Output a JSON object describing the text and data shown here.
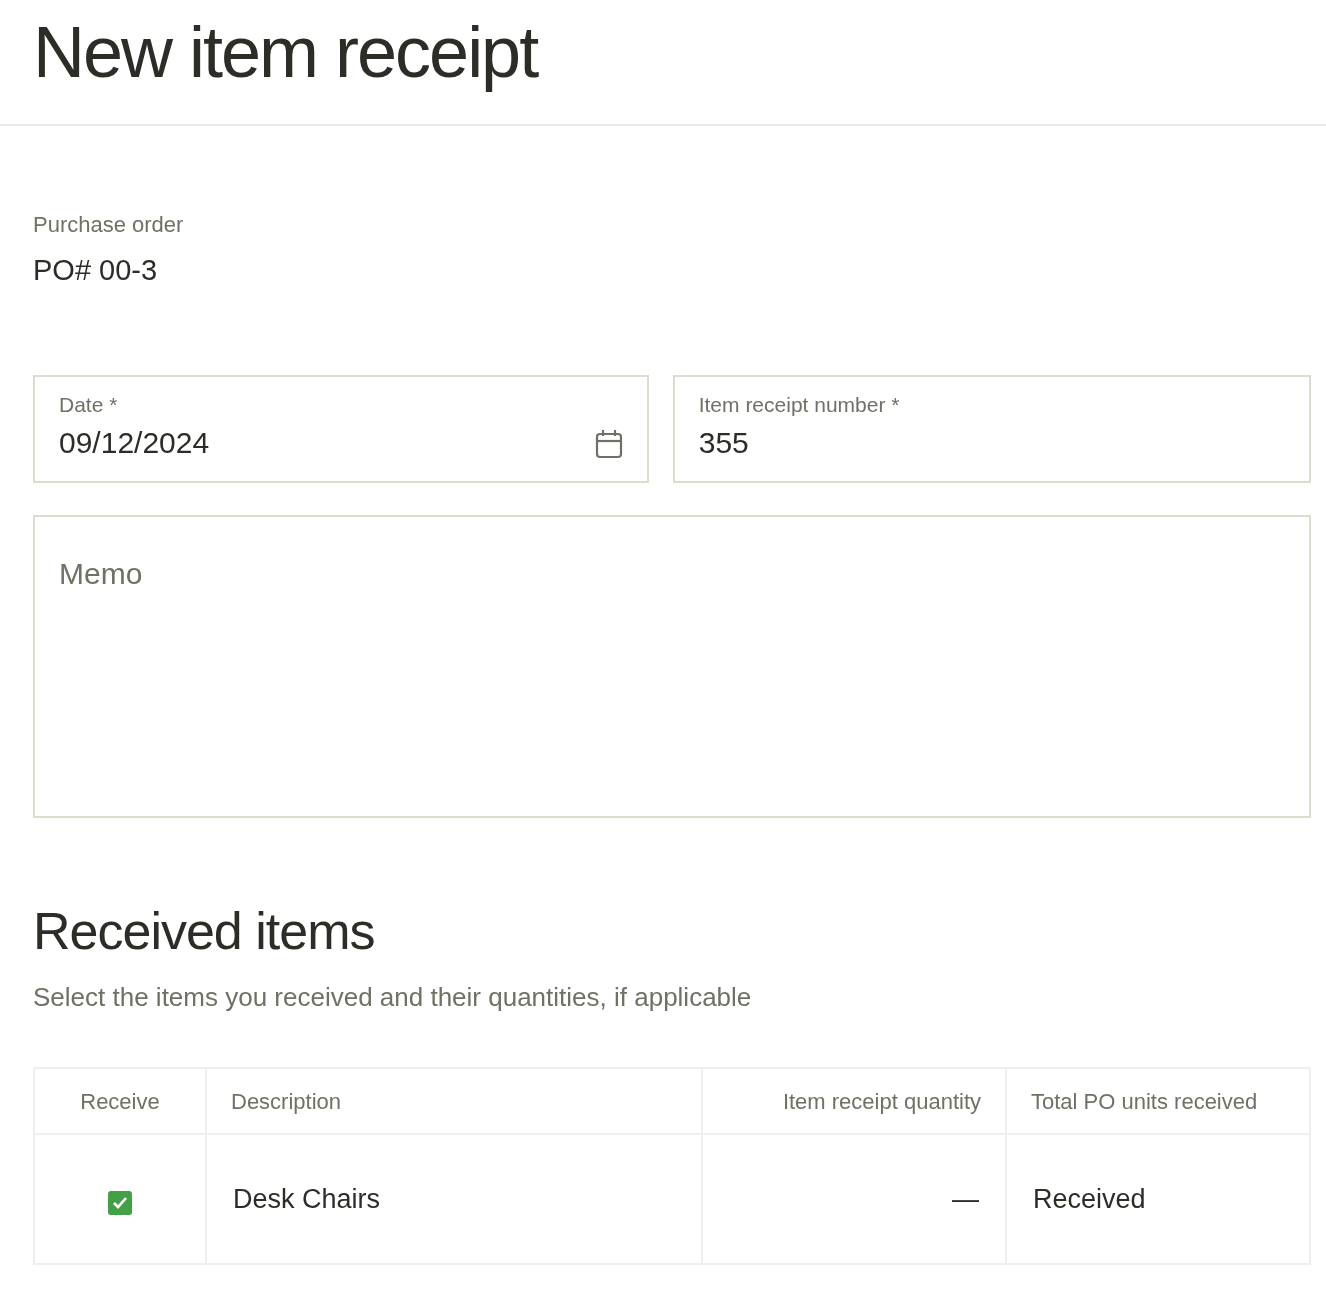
{
  "page": {
    "title": "New item receipt"
  },
  "purchase_order": {
    "label": "Purchase order",
    "value": "PO# 00-3"
  },
  "fields": [
    {
      "label": "Date *",
      "value": "09/12/2024",
      "kind": "date"
    },
    {
      "label": "Item receipt number *",
      "value": "355",
      "kind": "text"
    }
  ],
  "memo": {
    "placeholder": "Memo"
  },
  "received_items": {
    "title": "Received items",
    "subtitle": "Select the items you received and their quantities, if applicable",
    "table": {
      "columns": [
        "Receive",
        "Description",
        "Item receipt quantity",
        "Total PO units received"
      ],
      "rows": [
        {
          "checked": true,
          "description": "Desk Chairs",
          "quantity": "—",
          "total": "Received"
        }
      ]
    }
  }
}
